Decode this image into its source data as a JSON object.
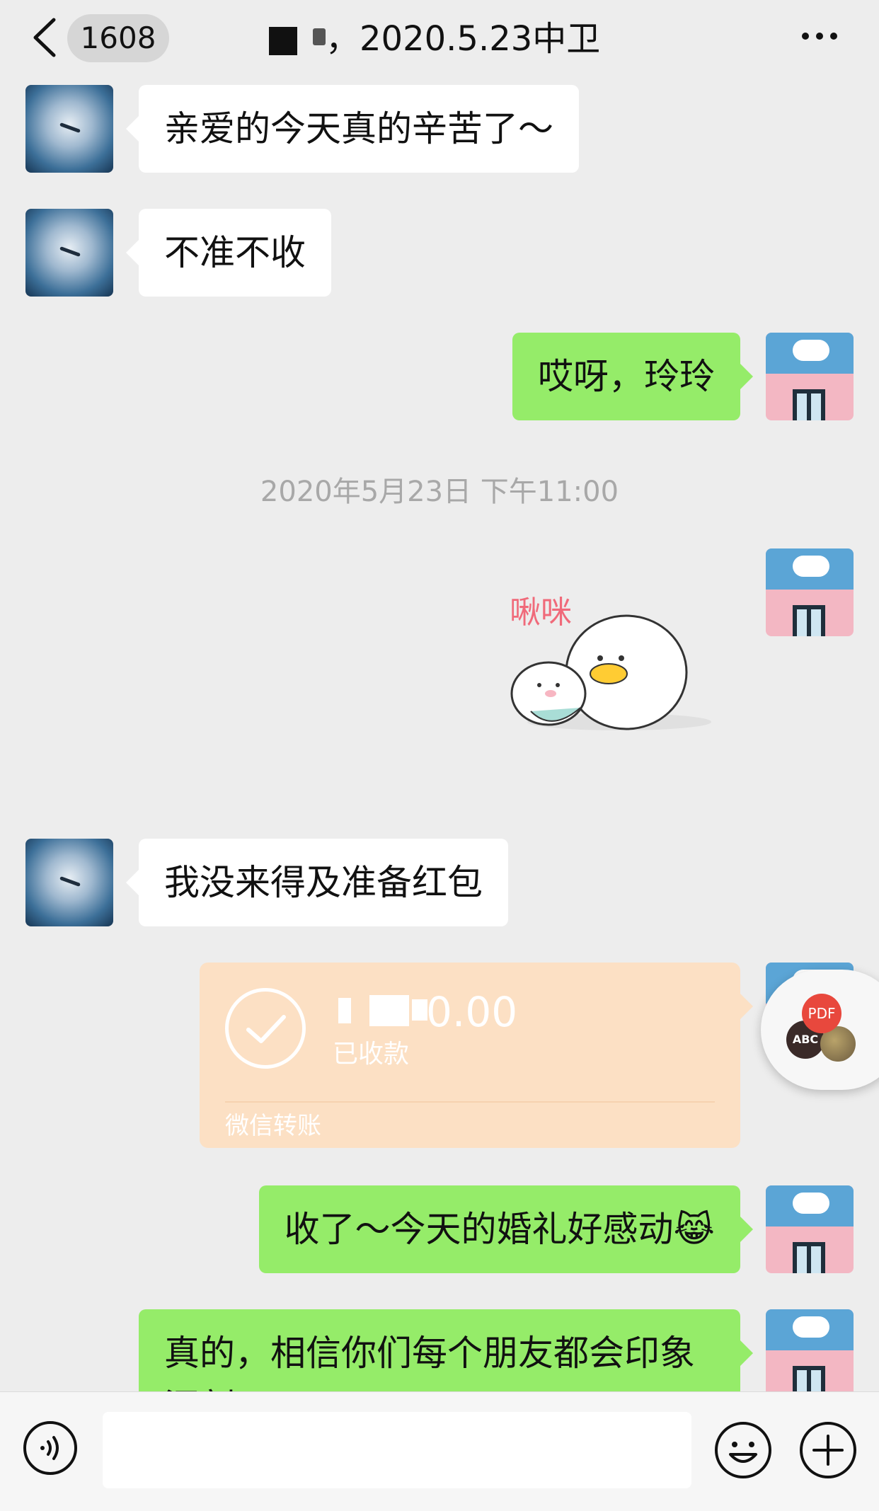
{
  "header": {
    "back_count": "1608",
    "title": "，2020.5.23中卫"
  },
  "messages": [
    {
      "side": "left",
      "text": "亲爱的今天真的辛苦了～"
    },
    {
      "side": "left",
      "text": "不准不收"
    },
    {
      "side": "right",
      "text": "哎呀，玲玲"
    },
    {
      "side": "left",
      "text": "我没来得及准备红包"
    },
    {
      "side": "right",
      "text": "收了～今天的婚礼好感动😹"
    },
    {
      "side": "right",
      "text": "真的，相信你们每个朋友都会印象深刻da"
    }
  ],
  "timestamp": "2020年5月23日 下午11:00",
  "sticker": {
    "text": "啾咪"
  },
  "transfer": {
    "amount": "0.00",
    "status": "已收款",
    "label": "微信转账"
  },
  "floater": {
    "pdf": "PDF",
    "abc": "ABC"
  },
  "input": {
    "placeholder": ""
  },
  "colors": {
    "background": "#ededed",
    "bubble_green": "#95ec69",
    "bubble_white": "#ffffff",
    "transfer_card": "#fce0c4"
  }
}
